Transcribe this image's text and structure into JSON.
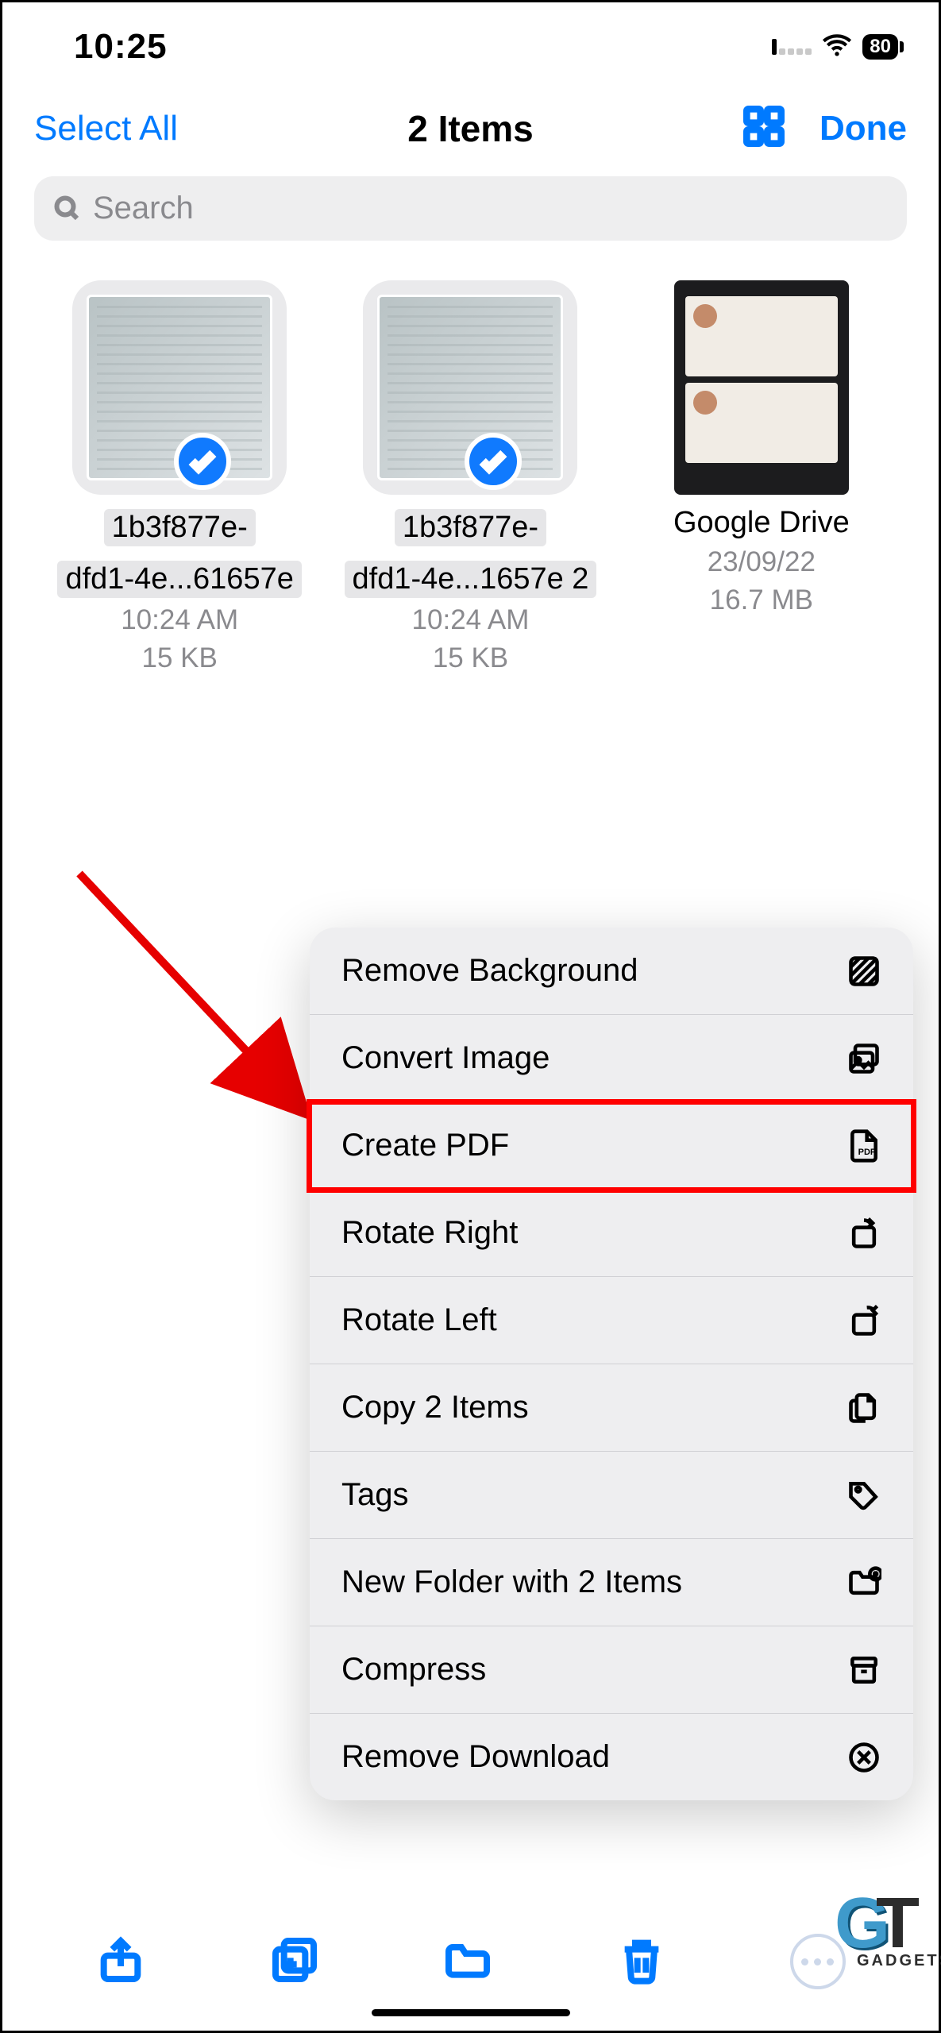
{
  "status": {
    "time": "10:25",
    "battery": "80"
  },
  "header": {
    "select_all": "Select All",
    "title": "2 Items",
    "done": "Done"
  },
  "search": {
    "placeholder": "Search"
  },
  "files": [
    {
      "name_line1": "1b3f877e-",
      "name_line2": "dfd1-4e...61657e",
      "time": "10:24 AM",
      "size": "15 KB"
    },
    {
      "name_line1": "1b3f877e-",
      "name_line2": "dfd1-4e...1657e 2",
      "time": "10:24 AM",
      "size": "15 KB"
    },
    {
      "name": "Google Drive",
      "date": "23/09/22",
      "size": "16.7 MB"
    }
  ],
  "menu": {
    "remove_background": "Remove Background",
    "convert_image": "Convert Image",
    "create_pdf": "Create PDF",
    "rotate_right": "Rotate Right",
    "rotate_left": "Rotate Left",
    "copy": "Copy 2 Items",
    "tags": "Tags",
    "new_folder": "New Folder with 2 Items",
    "compress": "Compress",
    "remove_download": "Remove Download"
  },
  "watermark": {
    "sub": "GADGETS"
  }
}
